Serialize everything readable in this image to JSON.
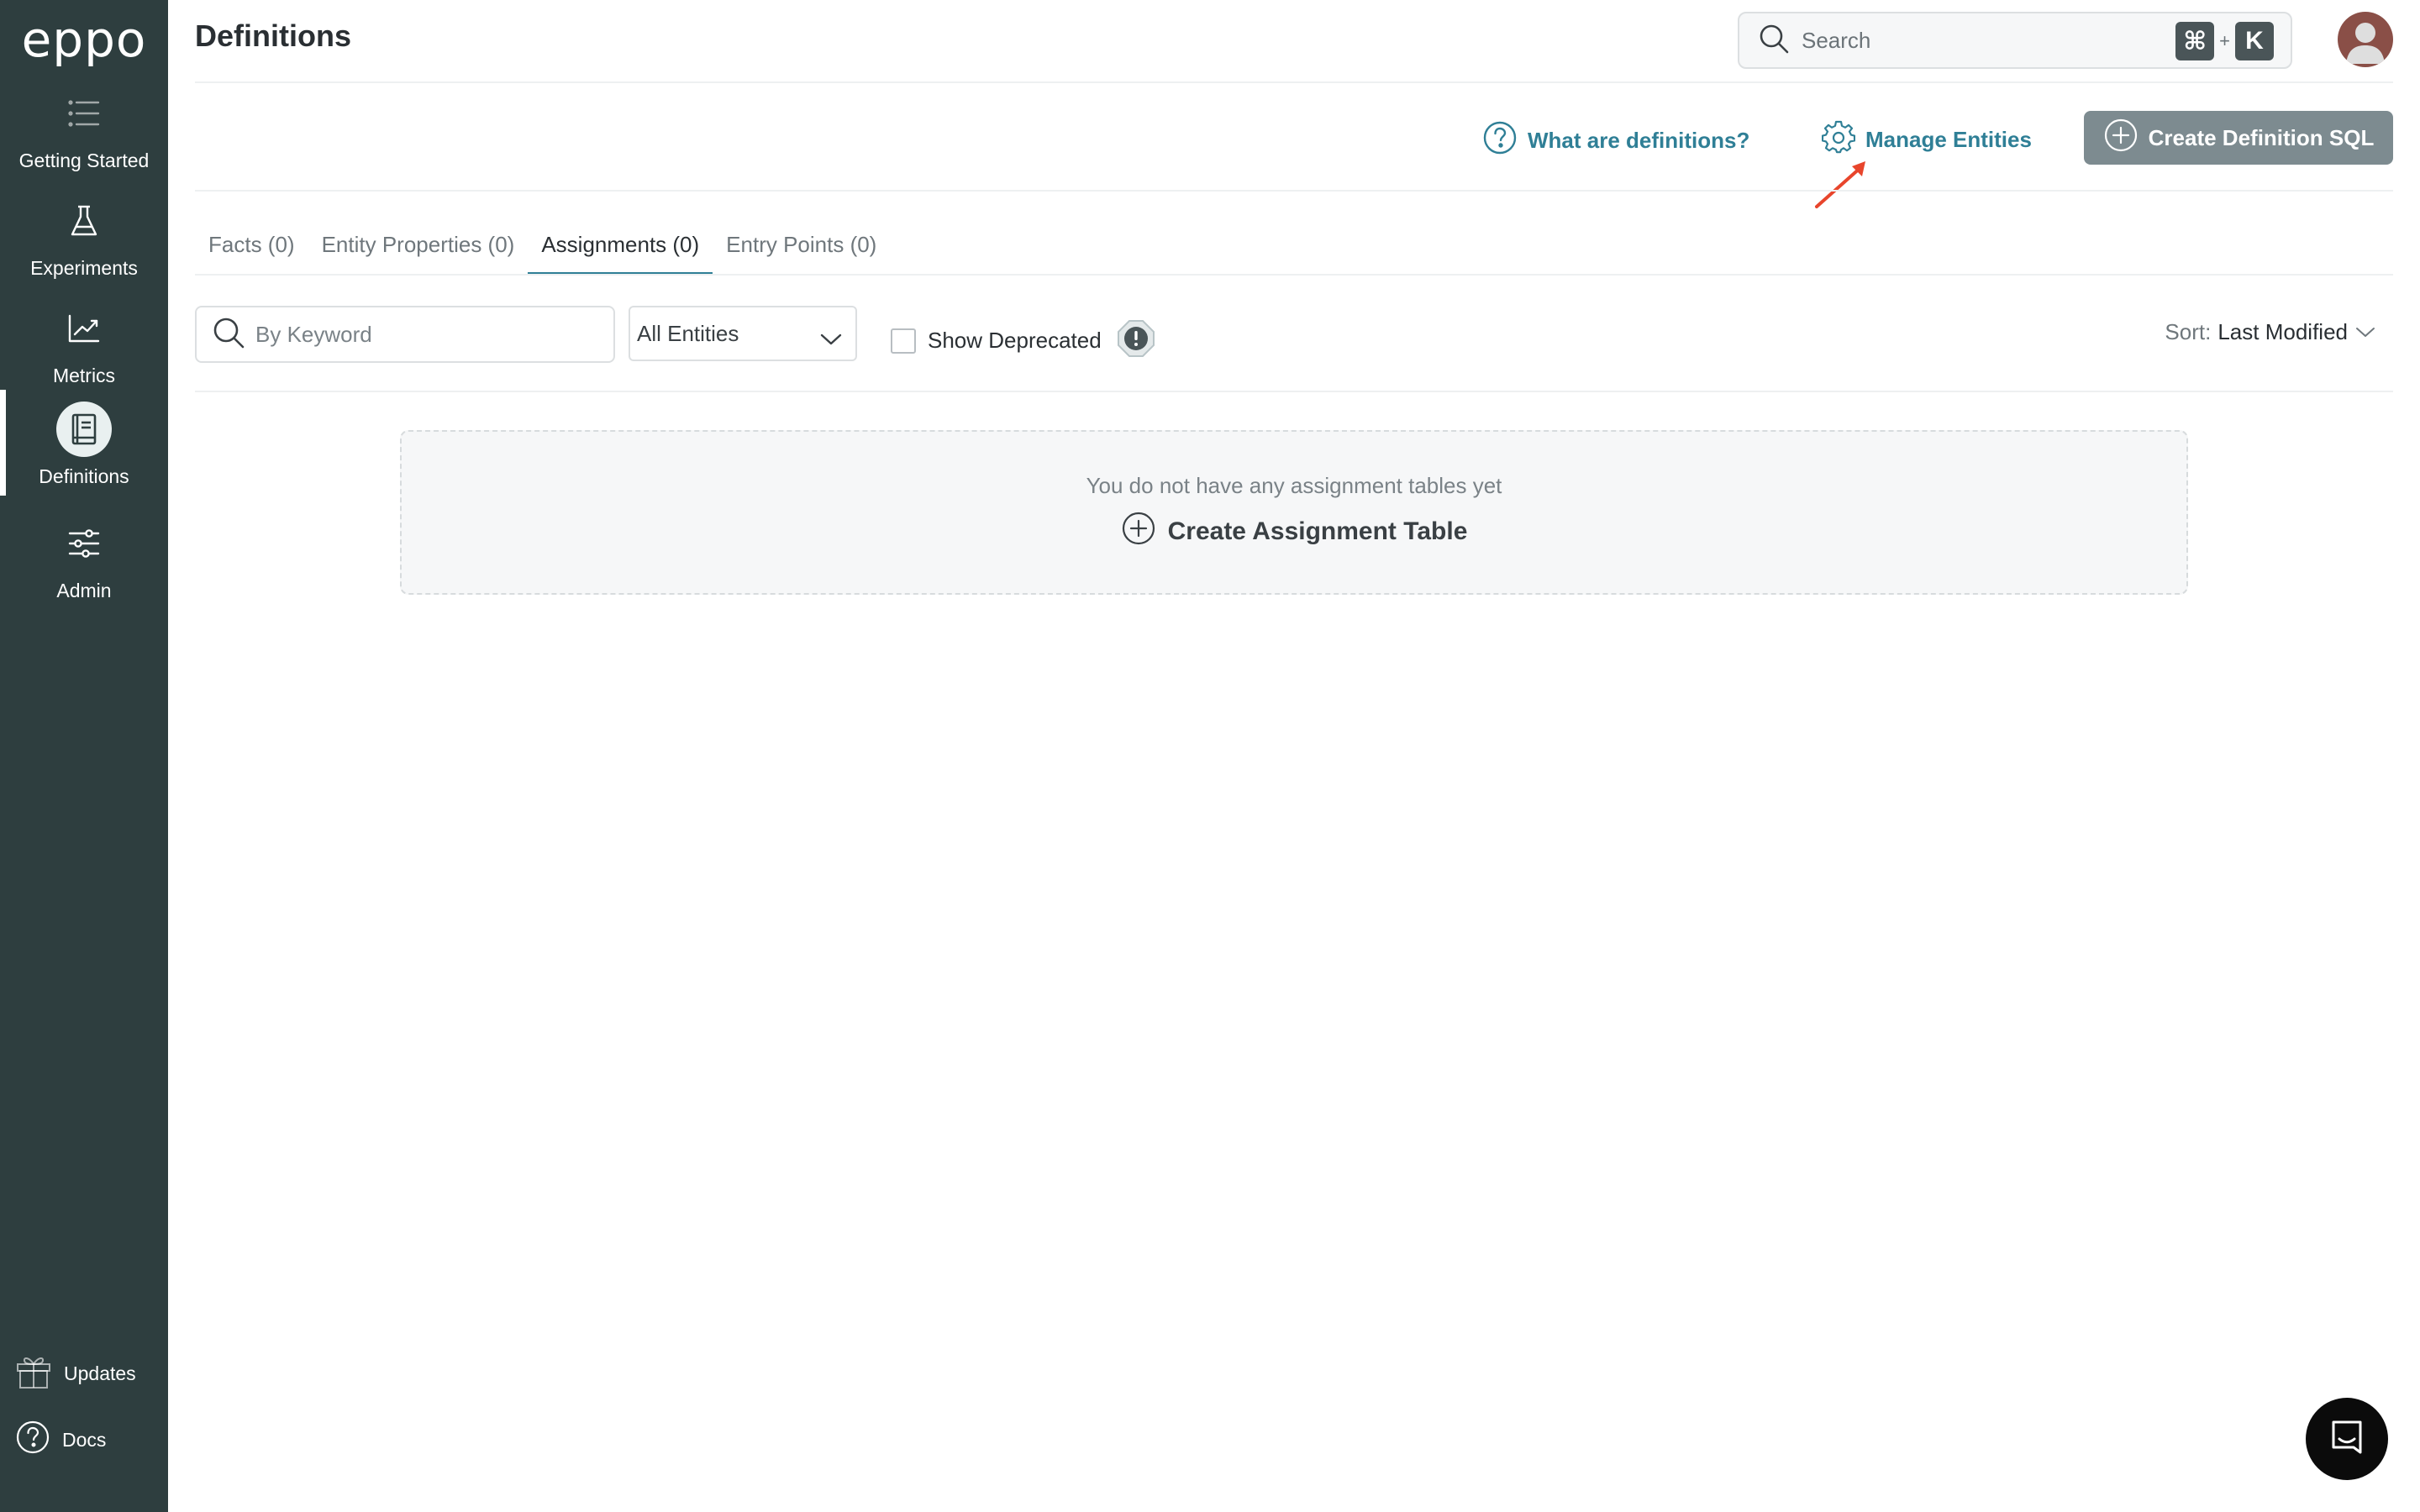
{
  "sidebar": {
    "logo": "eppo",
    "items": [
      {
        "label": "Getting Started",
        "icon": "list-icon"
      },
      {
        "label": "Experiments",
        "icon": "flask-icon"
      },
      {
        "label": "Metrics",
        "icon": "trend-chart-icon"
      },
      {
        "label": "Definitions",
        "icon": "book-icon",
        "active": true
      },
      {
        "label": "Admin",
        "icon": "sliders-icon"
      }
    ],
    "bottom": {
      "updates": "Updates",
      "docs": "Docs"
    }
  },
  "header": {
    "title": "Definitions",
    "search_placeholder": "Search",
    "shortcut_cmd": "⌘",
    "shortcut_plus": "+",
    "shortcut_key": "K"
  },
  "actions": {
    "help_link": "What are definitions?",
    "manage_link": "Manage Entities",
    "create_button": "Create Definition SQL"
  },
  "tabs": [
    {
      "label": "Facts (0)"
    },
    {
      "label": "Entity Properties (0)"
    },
    {
      "label": "Assignments (0)",
      "active": true
    },
    {
      "label": "Entry Points (0)"
    }
  ],
  "filters": {
    "keyword_placeholder": "By Keyword",
    "entity_select": "All Entities",
    "show_deprecated": "Show Deprecated",
    "show_deprecated_checked": false,
    "sort_label": "Sort:",
    "sort_value": "Last Modified"
  },
  "empty_state": {
    "message": "You do not have any assignment tables yet",
    "cta": "Create Assignment Table"
  },
  "colors": {
    "sidebar_bg": "#2e3e3f",
    "link": "#2f7f96",
    "primary_button_disabled": "#7d8b90",
    "annotation_arrow": "#e8452c"
  }
}
